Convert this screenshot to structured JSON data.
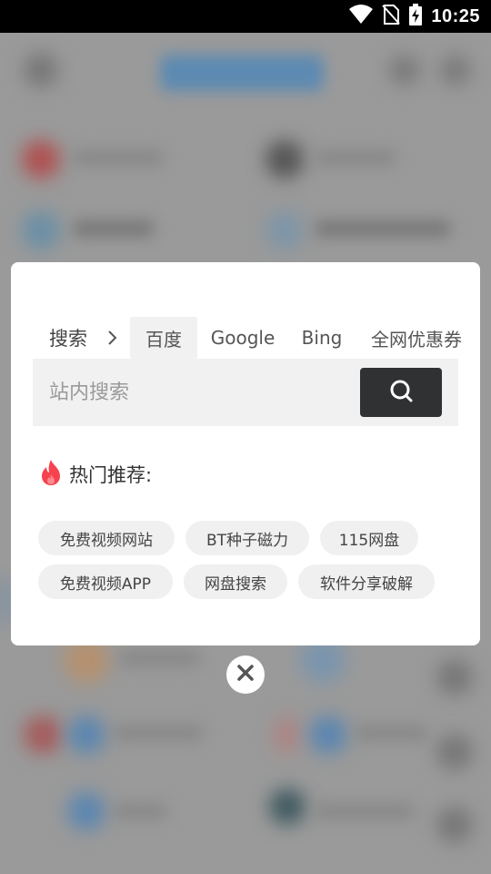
{
  "status_bar": {
    "time": "10:25",
    "icons": [
      "wifi-icon",
      "no-sim-icon",
      "battery-charging-icon"
    ]
  },
  "search_dialog": {
    "tabs_prefix": "搜索",
    "tabs": [
      {
        "label": "百度",
        "active": true
      },
      {
        "label": "Google",
        "active": false
      },
      {
        "label": "Bing",
        "active": false
      },
      {
        "label": "全网优惠券",
        "active": false
      }
    ],
    "search": {
      "placeholder": "站内搜索",
      "value": ""
    },
    "hot": {
      "title": "热门推荐:",
      "tags": [
        "免费视频网站",
        "BT种子磁力",
        "115网盘",
        "免费视频APP",
        "网盘搜索",
        "软件分享破解"
      ]
    }
  },
  "colors": {
    "accent_fire": "#f5434f",
    "search_button": "#2f3133",
    "chip_bg": "#f0f0f0",
    "overlay": "#8a8a8a"
  }
}
